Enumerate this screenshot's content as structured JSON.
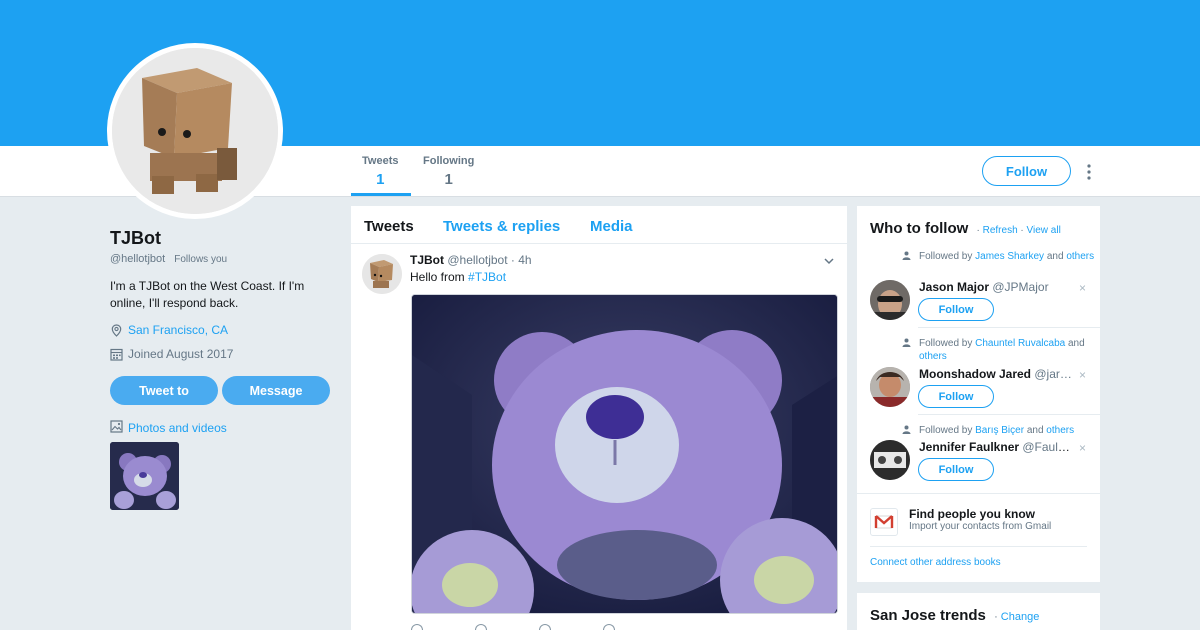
{
  "profile": {
    "name": "TJBot",
    "handle": "@hellotjbot",
    "follows_you": "Follows you",
    "bio": "I'm a TJBot on the West Coast. If I'm online, I'll respond back.",
    "location": "San Francisco, CA",
    "joined": "Joined August 2017",
    "tweet_to_label": "Tweet to",
    "message_label": "Message",
    "photos_label": "Photos and videos"
  },
  "nav": {
    "stats": [
      {
        "label": "Tweets",
        "value": "1"
      },
      {
        "label": "Following",
        "value": "1"
      }
    ],
    "follow_label": "Follow"
  },
  "timeline": {
    "tabs": [
      "Tweets",
      "Tweets & replies",
      "Media"
    ],
    "tweet": {
      "name": "TJBot",
      "handle": "@hellotjbot",
      "separator": "·",
      "time": "4h",
      "text": "Hello from ",
      "hashtag": "#TJBot"
    }
  },
  "who_to_follow": {
    "title": "Who to follow",
    "dot": "·",
    "refresh": "Refresh",
    "view_all": "View all",
    "items": [
      {
        "followed_by": "Followed by",
        "person": "James Sharkey",
        "and": "and",
        "others": "others",
        "name": "Jason Major",
        "handle": "@JPMajor",
        "follow_label": "Follow"
      },
      {
        "followed_by": "Followed by",
        "person": "Chauntel Ruvalcaba",
        "and": "and",
        "others": "others",
        "name": "Moonshadow Jared",
        "handle": "@jar…",
        "follow_label": "Follow"
      },
      {
        "followed_by": "Followed by",
        "person": "Barış Biçer",
        "and": "and",
        "others": "others",
        "name": "Jennifer Faulkner",
        "handle": "@Faulk…",
        "follow_label": "Follow"
      }
    ],
    "dismiss_glyph": "×",
    "find_title": "Find people you know",
    "find_sub": "Import your contacts from Gmail",
    "connect": "Connect other address books"
  },
  "trends": {
    "title": "San Jose trends",
    "dot": "·",
    "change": "Change"
  },
  "colors": {
    "brand": "#1da1f2",
    "background": "#e6ecf0",
    "muted": "#657786"
  }
}
